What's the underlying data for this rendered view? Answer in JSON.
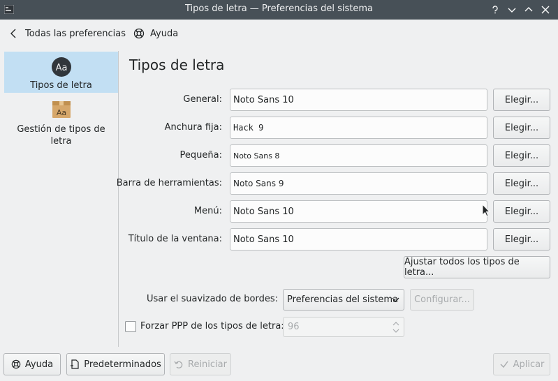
{
  "window": {
    "title": "Tipos de letra — Preferencias del sistema",
    "controls": [
      "help-icon",
      "minimize-icon",
      "maximize-icon",
      "close-icon"
    ]
  },
  "nav": {
    "back_label": "Todas las preferencias",
    "help_label": "Ayuda"
  },
  "sidebar": {
    "items": [
      {
        "label": "Tipos de letra",
        "icon": "font-icon",
        "selected": true
      },
      {
        "label": "Gestión de tipos de letra",
        "icon": "font-package-icon",
        "selected": false
      }
    ]
  },
  "icon_text": "Aa",
  "page": {
    "title": "Tipos de letra",
    "choose_label": "Elegir...",
    "fonts": [
      {
        "label": "General:",
        "value": "Noto Sans 10"
      },
      {
        "label": "Anchura fija:",
        "value": "Hack 9"
      },
      {
        "label": "Pequeña:",
        "value": "Noto Sans 8"
      },
      {
        "label": "Barra de herramientas:",
        "value": "Noto Sans 9"
      },
      {
        "label": "Menú:",
        "value": "Noto Sans 10"
      },
      {
        "label": "Título de la ventana:",
        "value": "Noto Sans 10"
      }
    ],
    "adjust_all_label": "Ajustar todos los tipos de letra...",
    "antialias": {
      "label": "Usar el suavizado de bordes:",
      "value": "Preferencias del sistema",
      "configure_label": "Configurar..."
    },
    "dpi": {
      "label": "Forzar PPP de los tipos de letra:",
      "checked": false,
      "value": "96"
    }
  },
  "footer": {
    "help_label": "Ayuda",
    "defaults_label": "Predeterminados",
    "reset_label": "Reiniciar",
    "apply_label": "Aplicar"
  },
  "colors": {
    "titlebar": "#475057",
    "selection": "#c2dff3",
    "window_bg": "#eff0f1"
  }
}
